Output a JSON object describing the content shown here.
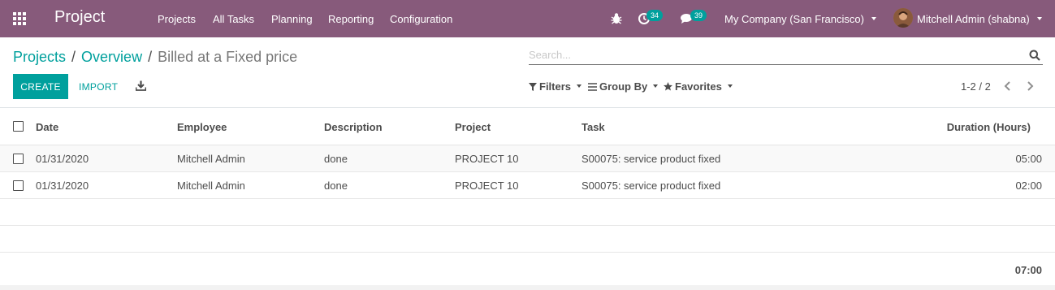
{
  "navbar": {
    "app_name": "Project",
    "menu": [
      "Projects",
      "All Tasks",
      "Planning",
      "Reporting",
      "Configuration"
    ],
    "activity_count": "34",
    "message_count": "39",
    "company": "My Company (San Francisco)",
    "user": "Mitchell Admin (shabna)"
  },
  "breadcrumb": {
    "items": [
      "Projects",
      "Overview"
    ],
    "separator": "/",
    "current": "Billed at a Fixed price"
  },
  "search": {
    "placeholder": "Search..."
  },
  "toolbar": {
    "create_label": "CREATE",
    "import_label": "IMPORT"
  },
  "search_options": {
    "filters": "Filters",
    "group_by": "Group By",
    "favorites": "Favorites"
  },
  "pager": {
    "value": "1-2 / 2"
  },
  "table": {
    "columns": [
      "Date",
      "Employee",
      "Description",
      "Project",
      "Task",
      "Duration (Hours)"
    ],
    "rows": [
      [
        "01/31/2020",
        "Mitchell Admin",
        "done",
        "PROJECT 10",
        "S00075: service product fixed",
        "05:00"
      ],
      [
        "01/31/2020",
        "Mitchell Admin",
        "done",
        "PROJECT 10",
        "S00075: service product fixed",
        "02:00"
      ]
    ],
    "total": "07:00"
  },
  "colors": {
    "navbar": "#875a7b",
    "accent": "#00a09d",
    "text": "#4c4c4c"
  },
  "icons": [
    "apps-menu-icon",
    "bug-icon",
    "activity-clock-icon",
    "chat-icon",
    "search-icon",
    "download-icon",
    "filter-icon",
    "group-by-icon",
    "star-icon",
    "chevron-left-icon",
    "chevron-right-icon"
  ]
}
